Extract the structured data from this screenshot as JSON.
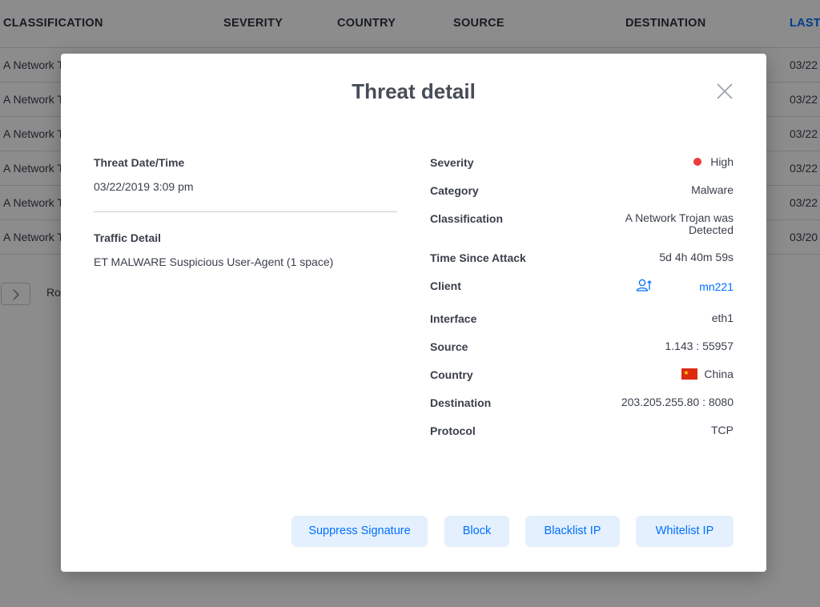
{
  "table": {
    "columns": {
      "classification": "CLASSIFICATION",
      "severity": "SEVERITY",
      "country": "COUNTRY",
      "source": "SOURCE",
      "destination": "DESTINATION",
      "last": "LAST"
    },
    "rows": [
      {
        "classification": "A Network T",
        "last": "03/22"
      },
      {
        "classification": "A Network T",
        "last": "03/22"
      },
      {
        "classification": "A Network T",
        "last": "03/22"
      },
      {
        "classification": "A Network T",
        "last": "03/22"
      },
      {
        "classification": "A Network T",
        "last": "03/22"
      },
      {
        "classification": "A Network T",
        "last": "03/20"
      }
    ],
    "pager_label": "Ro"
  },
  "modal": {
    "title": "Threat detail",
    "threat_datetime_label": "Threat Date/Time",
    "threat_datetime_value": "03/22/2019 3:09 pm",
    "traffic_detail_label": "Traffic Detail",
    "traffic_detail_value": "ET MALWARE Suspicious User-Agent (1 space)",
    "details": {
      "severity_label": "Severity",
      "severity_value": "High",
      "severity_color": "#f03a3a",
      "category_label": "Category",
      "category_value": "Malware",
      "classification_label": "Classification",
      "classification_value": "A Network Trojan was Detected",
      "time_since_label": "Time Since Attack",
      "time_since_value": "5d 4h 40m 59s",
      "client_label": "Client",
      "client_value": "mn221",
      "client_icon": "user-upload-icon",
      "interface_label": "Interface",
      "interface_value": "eth1",
      "source_label": "Source",
      "source_value": "1.143 : 55957",
      "country_label": "Country",
      "country_value": "China",
      "country_icon": "china-flag-icon",
      "destination_label": "Destination",
      "destination_value": "203.205.255.80 : 8080",
      "protocol_label": "Protocol",
      "protocol_value": "TCP"
    },
    "buttons": {
      "suppress": "Suppress Signature",
      "block": "Block",
      "blacklist": "Blacklist IP",
      "whitelist": "Whitelist IP"
    }
  },
  "colors": {
    "accent": "#006fff",
    "button_bg": "#e4f0fd",
    "overlay": "rgba(0,0,0,0.45)"
  }
}
